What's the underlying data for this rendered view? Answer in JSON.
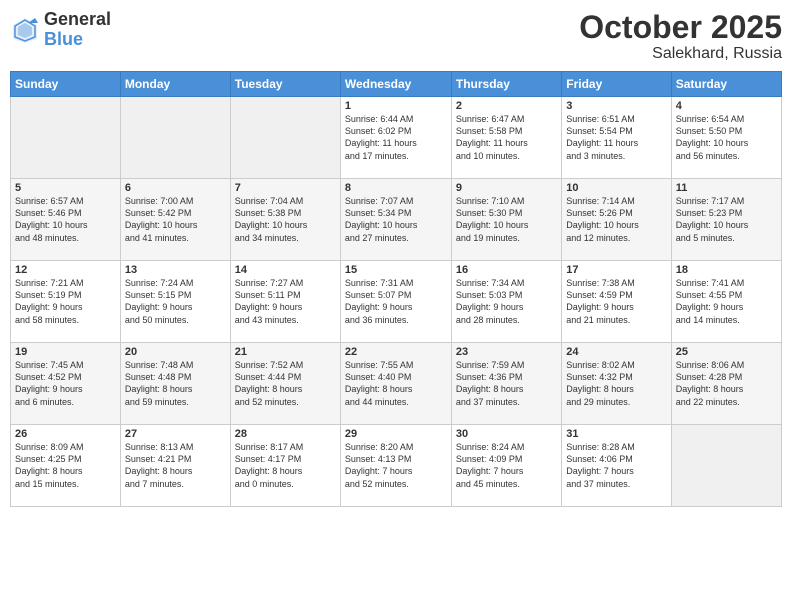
{
  "logo": {
    "general": "General",
    "blue": "Blue"
  },
  "title": "October 2025",
  "location": "Salekhard, Russia",
  "days_header": [
    "Sunday",
    "Monday",
    "Tuesday",
    "Wednesday",
    "Thursday",
    "Friday",
    "Saturday"
  ],
  "weeks": [
    [
      {
        "day": "",
        "info": ""
      },
      {
        "day": "",
        "info": ""
      },
      {
        "day": "",
        "info": ""
      },
      {
        "day": "1",
        "info": "Sunrise: 6:44 AM\nSunset: 6:02 PM\nDaylight: 11 hours\nand 17 minutes."
      },
      {
        "day": "2",
        "info": "Sunrise: 6:47 AM\nSunset: 5:58 PM\nDaylight: 11 hours\nand 10 minutes."
      },
      {
        "day": "3",
        "info": "Sunrise: 6:51 AM\nSunset: 5:54 PM\nDaylight: 11 hours\nand 3 minutes."
      },
      {
        "day": "4",
        "info": "Sunrise: 6:54 AM\nSunset: 5:50 PM\nDaylight: 10 hours\nand 56 minutes."
      }
    ],
    [
      {
        "day": "5",
        "info": "Sunrise: 6:57 AM\nSunset: 5:46 PM\nDaylight: 10 hours\nand 48 minutes."
      },
      {
        "day": "6",
        "info": "Sunrise: 7:00 AM\nSunset: 5:42 PM\nDaylight: 10 hours\nand 41 minutes."
      },
      {
        "day": "7",
        "info": "Sunrise: 7:04 AM\nSunset: 5:38 PM\nDaylight: 10 hours\nand 34 minutes."
      },
      {
        "day": "8",
        "info": "Sunrise: 7:07 AM\nSunset: 5:34 PM\nDaylight: 10 hours\nand 27 minutes."
      },
      {
        "day": "9",
        "info": "Sunrise: 7:10 AM\nSunset: 5:30 PM\nDaylight: 10 hours\nand 19 minutes."
      },
      {
        "day": "10",
        "info": "Sunrise: 7:14 AM\nSunset: 5:26 PM\nDaylight: 10 hours\nand 12 minutes."
      },
      {
        "day": "11",
        "info": "Sunrise: 7:17 AM\nSunset: 5:23 PM\nDaylight: 10 hours\nand 5 minutes."
      }
    ],
    [
      {
        "day": "12",
        "info": "Sunrise: 7:21 AM\nSunset: 5:19 PM\nDaylight: 9 hours\nand 58 minutes."
      },
      {
        "day": "13",
        "info": "Sunrise: 7:24 AM\nSunset: 5:15 PM\nDaylight: 9 hours\nand 50 minutes."
      },
      {
        "day": "14",
        "info": "Sunrise: 7:27 AM\nSunset: 5:11 PM\nDaylight: 9 hours\nand 43 minutes."
      },
      {
        "day": "15",
        "info": "Sunrise: 7:31 AM\nSunset: 5:07 PM\nDaylight: 9 hours\nand 36 minutes."
      },
      {
        "day": "16",
        "info": "Sunrise: 7:34 AM\nSunset: 5:03 PM\nDaylight: 9 hours\nand 28 minutes."
      },
      {
        "day": "17",
        "info": "Sunrise: 7:38 AM\nSunset: 4:59 PM\nDaylight: 9 hours\nand 21 minutes."
      },
      {
        "day": "18",
        "info": "Sunrise: 7:41 AM\nSunset: 4:55 PM\nDaylight: 9 hours\nand 14 minutes."
      }
    ],
    [
      {
        "day": "19",
        "info": "Sunrise: 7:45 AM\nSunset: 4:52 PM\nDaylight: 9 hours\nand 6 minutes."
      },
      {
        "day": "20",
        "info": "Sunrise: 7:48 AM\nSunset: 4:48 PM\nDaylight: 8 hours\nand 59 minutes."
      },
      {
        "day": "21",
        "info": "Sunrise: 7:52 AM\nSunset: 4:44 PM\nDaylight: 8 hours\nand 52 minutes."
      },
      {
        "day": "22",
        "info": "Sunrise: 7:55 AM\nSunset: 4:40 PM\nDaylight: 8 hours\nand 44 minutes."
      },
      {
        "day": "23",
        "info": "Sunrise: 7:59 AM\nSunset: 4:36 PM\nDaylight: 8 hours\nand 37 minutes."
      },
      {
        "day": "24",
        "info": "Sunrise: 8:02 AM\nSunset: 4:32 PM\nDaylight: 8 hours\nand 29 minutes."
      },
      {
        "day": "25",
        "info": "Sunrise: 8:06 AM\nSunset: 4:28 PM\nDaylight: 8 hours\nand 22 minutes."
      }
    ],
    [
      {
        "day": "26",
        "info": "Sunrise: 8:09 AM\nSunset: 4:25 PM\nDaylight: 8 hours\nand 15 minutes."
      },
      {
        "day": "27",
        "info": "Sunrise: 8:13 AM\nSunset: 4:21 PM\nDaylight: 8 hours\nand 7 minutes."
      },
      {
        "day": "28",
        "info": "Sunrise: 8:17 AM\nSunset: 4:17 PM\nDaylight: 8 hours\nand 0 minutes."
      },
      {
        "day": "29",
        "info": "Sunrise: 8:20 AM\nSunset: 4:13 PM\nDaylight: 7 hours\nand 52 minutes."
      },
      {
        "day": "30",
        "info": "Sunrise: 8:24 AM\nSunset: 4:09 PM\nDaylight: 7 hours\nand 45 minutes."
      },
      {
        "day": "31",
        "info": "Sunrise: 8:28 AM\nSunset: 4:06 PM\nDaylight: 7 hours\nand 37 minutes."
      },
      {
        "day": "",
        "info": ""
      }
    ]
  ]
}
